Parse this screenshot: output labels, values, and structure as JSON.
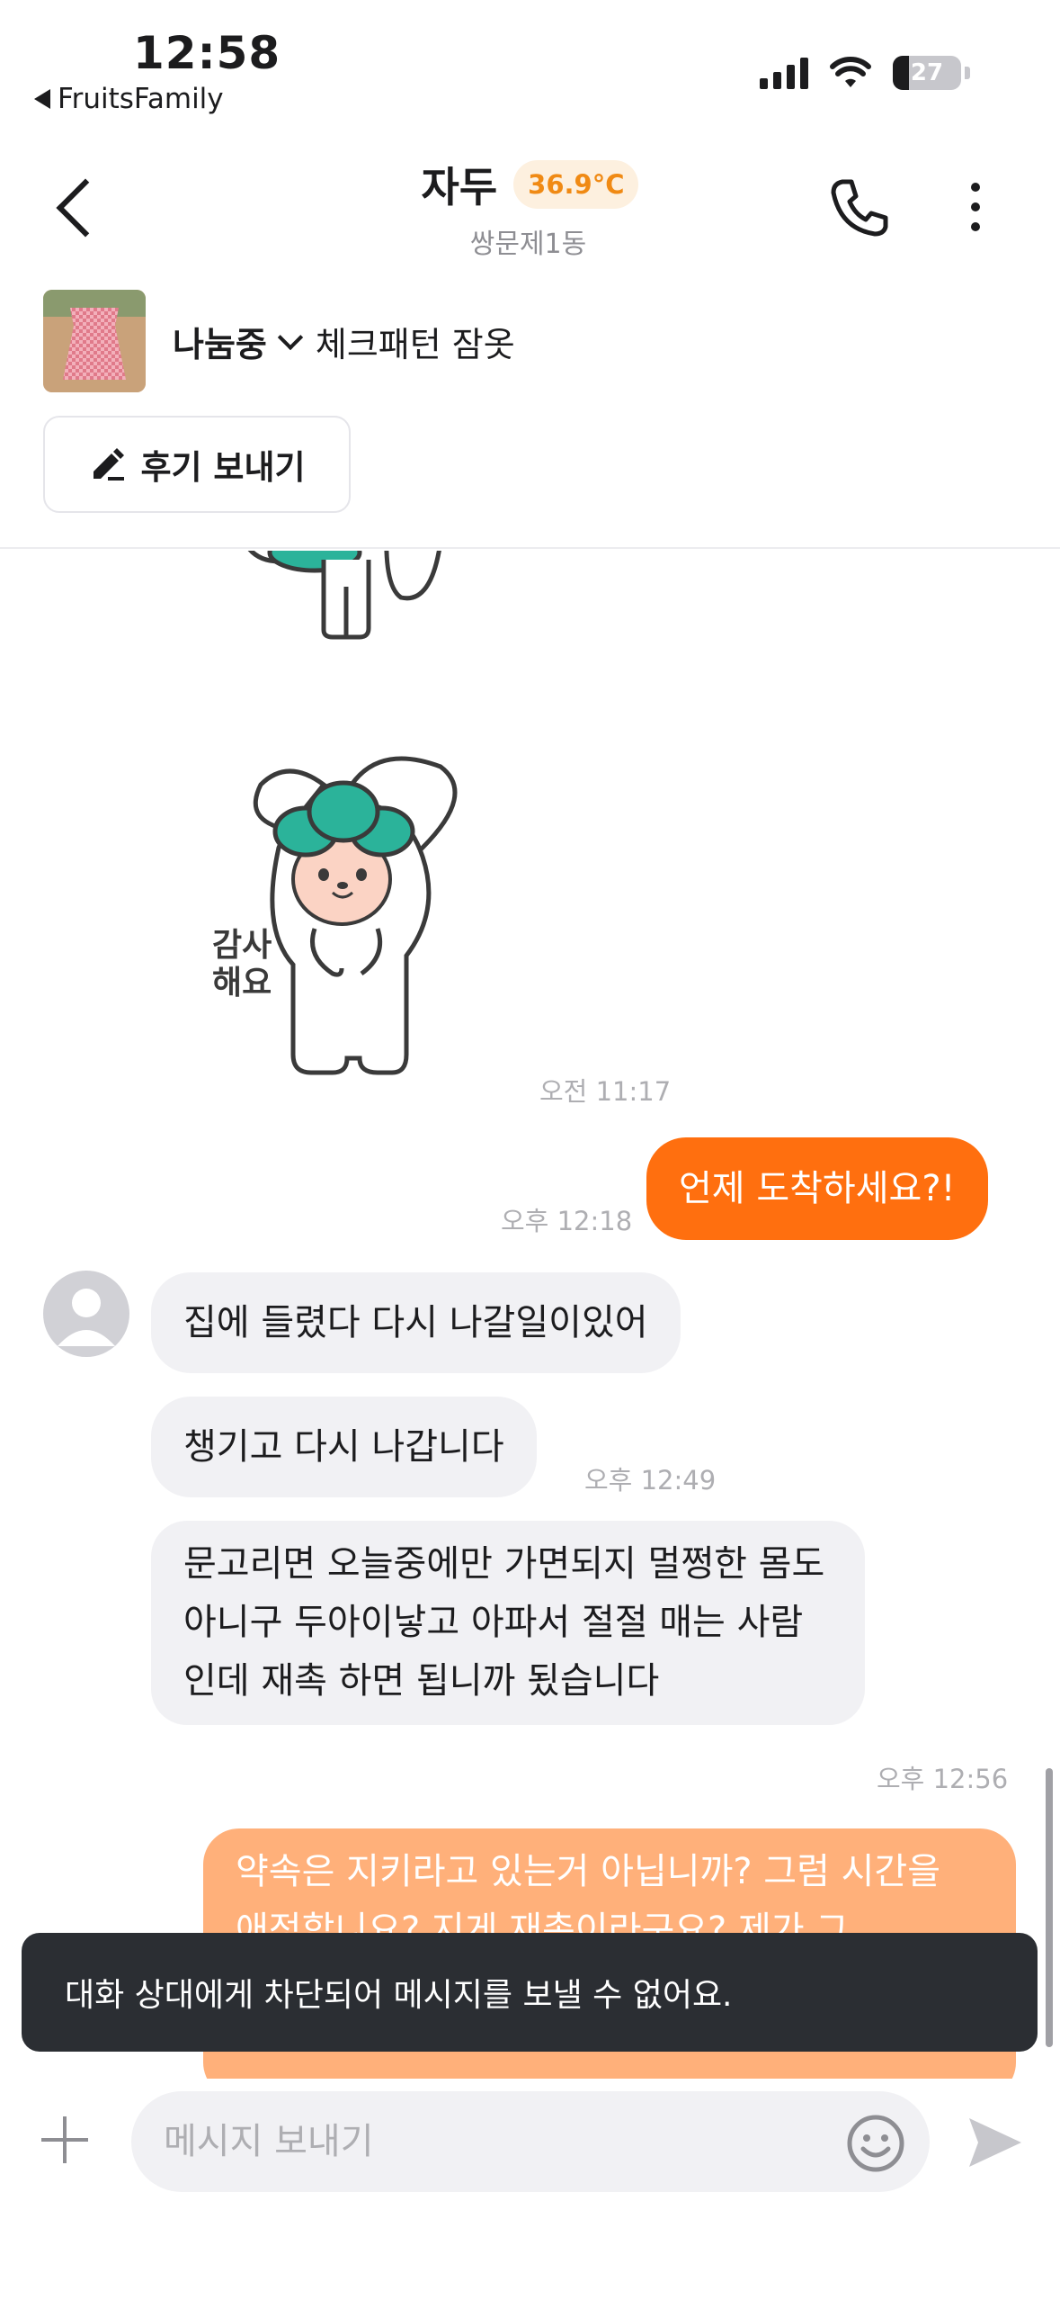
{
  "status_bar": {
    "time": "12:58",
    "back_app": "FruitsFamily",
    "battery": "27"
  },
  "header": {
    "name": "자두",
    "temperature": "36.9°C",
    "location": "쌍문제1동"
  },
  "product": {
    "status": "나눔중",
    "name": "체크패턴 잠옷",
    "review_button": "후기 보내기"
  },
  "chat": {
    "sticker_text": "감사\n해요",
    "sticker_time": "오전 11:17",
    "messages": [
      {
        "side": "out",
        "text": "언제 도착하세요?!",
        "time": "오후 12:18"
      },
      {
        "side": "in",
        "text": "집에 들렸다 다시 나갈일이있어",
        "time": ""
      },
      {
        "side": "in",
        "text": "챙기고 다시 나갑니다",
        "time": "오후 12:49"
      },
      {
        "side": "in",
        "text": "문고리면  오늘중에만 가면되지 멀쩡한 몸도 아니구 두아이낳고 아파서 절절 매는 사람인데 재촉 하면 됩니까 됬습니다",
        "time": "오후 12:56"
      },
      {
        "side": "out",
        "text": "약속은 지키라고 있는거 아닙니까? 그럼 시간을 애정합니요? 지게 재촉이라구요? 제가 그",
        "time": ""
      }
    ]
  },
  "toast": {
    "text": "대화 상대에게 차단되어 메시지를 보낼 수 없어요."
  },
  "input": {
    "placeholder": "메시지 보내기",
    "value": ""
  },
  "colors": {
    "accent": "#ff6f0f",
    "temp": "#f08a14",
    "sticker_green": "#2bb39a"
  }
}
